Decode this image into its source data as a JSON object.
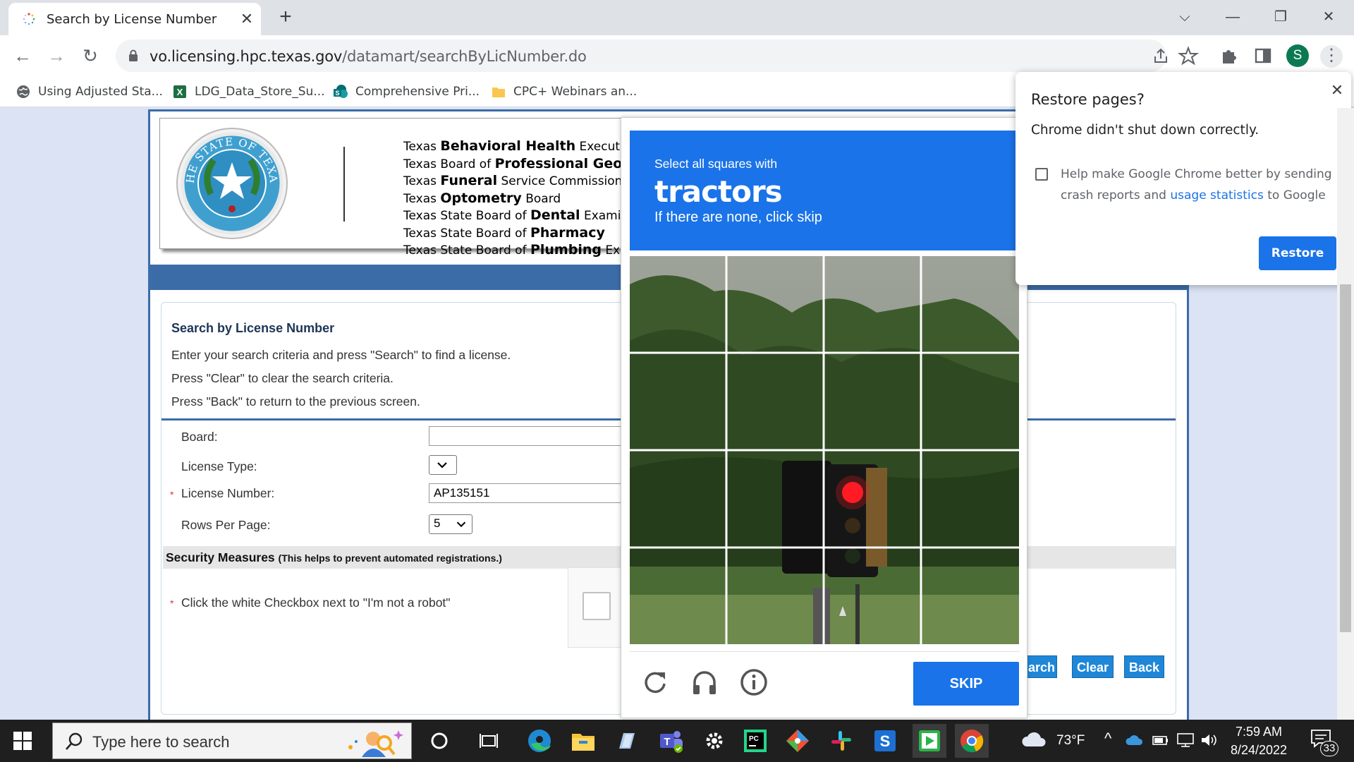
{
  "browser": {
    "tab_title": "Search by License Number",
    "url_host": "vo.licensing.hpc.texas.gov",
    "url_path": "/datamart/searchByLicNumber.do",
    "profile_initial": "S",
    "bookmarks": [
      "Using Adjusted Sta...",
      "LDG_Data_Store_Su...",
      "Comprehensive Pri...",
      "CPC+ Webinars an..."
    ]
  },
  "header": {
    "seal_text": "THE STATE OF TEXAS",
    "boards": [
      {
        "pre": "Texas ",
        "big": "Behavioral Health",
        "post": " Executive Co"
      },
      {
        "pre": "Texas Board of ",
        "big": "Professional Geoscient",
        "post": ""
      },
      {
        "pre": "Texas ",
        "big": "Funeral",
        "post": " Service Commission"
      },
      {
        "pre": "Texas ",
        "big": "Optometry",
        "post": " Board"
      },
      {
        "pre": "Texas State Board of ",
        "big": "Dental",
        "post": " Examiners"
      },
      {
        "pre": "Texas State Board of ",
        "big": "Pharmacy",
        "post": ""
      },
      {
        "pre": "Texas State Board of ",
        "big": "Plumbing",
        "post": " Examir"
      }
    ]
  },
  "form": {
    "title": "Search by License Number",
    "instructions": [
      "Enter your search criteria and press \"Search\" to find a license.",
      "Press \"Clear\" to clear the search criteria.",
      "Press \"Back\" to return to the previous screen."
    ],
    "board_label": "Board:",
    "license_type_label": "License Type:",
    "license_number_label": "License Number:",
    "license_number_value": "AP135151",
    "rows_per_page_label": "Rows Per Page:",
    "rows_per_page_value": "5",
    "security_title": "Security Measures",
    "security_note": "(This helps to prevent automated registrations.)",
    "robot_instruction": "Click the white Checkbox next to \"I'm not a robot\"",
    "buttons": {
      "search": "arch",
      "clear": "Clear",
      "back": "Back"
    }
  },
  "captcha": {
    "line1": "Select all squares with",
    "target": "tractors",
    "line3": "If there are none, click skip",
    "skip_label": "SKIP",
    "icons": [
      "reload-icon",
      "headphones-icon",
      "info-icon"
    ]
  },
  "restore_popup": {
    "title": "Restore pages?",
    "subtitle": "Chrome didn't shut down correctly.",
    "help_pre": "Help make Google Chrome better by sending crash reports and ",
    "help_link": "usage statistics",
    "help_post": " to Google",
    "button": "Restore"
  },
  "taskbar": {
    "search_placeholder": "Type here to search",
    "temperature": "73°F",
    "time": "7:59 AM",
    "date": "8/24/2022",
    "notification_count": "33"
  }
}
